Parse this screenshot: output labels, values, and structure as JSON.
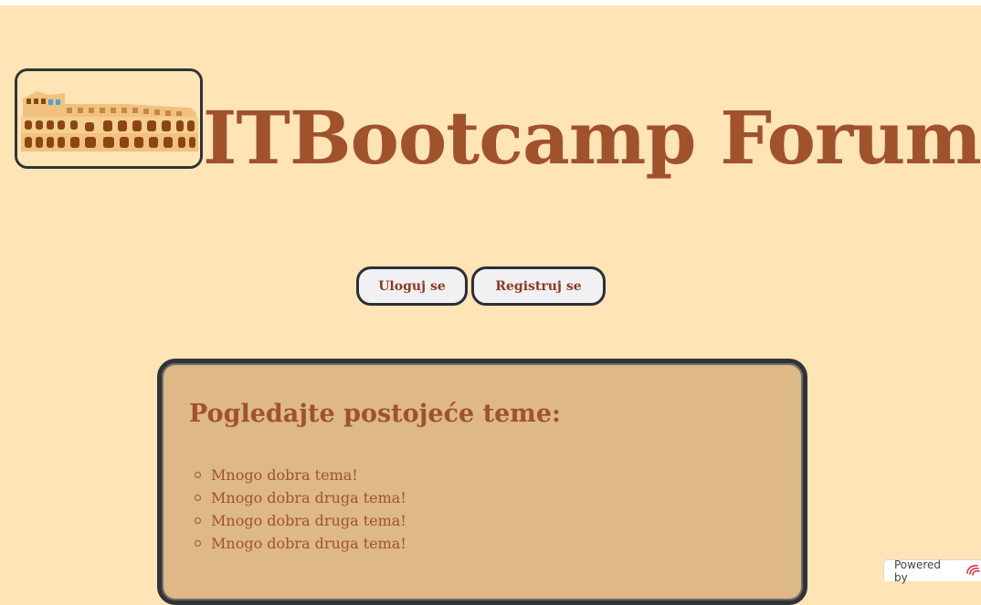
{
  "header": {
    "logo_icon": "colosseum-logo",
    "title": "ITBootcamp Forum"
  },
  "auth": {
    "login_label": "Uloguj se",
    "register_label": "Registruj se"
  },
  "topics": {
    "heading": "Pogledajte postojeće teme:",
    "items": [
      "Mnogo dobra tema!",
      "Mnogo dobra druga tema!",
      "Mnogo dobra druga tema!",
      "Mnogo dobra druga tema!"
    ]
  },
  "footer_badge": {
    "label": "Powered by",
    "icon": "powered-by-logo-icon"
  },
  "colors": {
    "page_background": "#ffe4b6",
    "title_brown": "#a0522d",
    "panel_tan": "#deb887",
    "border_dark": "#2f3437"
  }
}
